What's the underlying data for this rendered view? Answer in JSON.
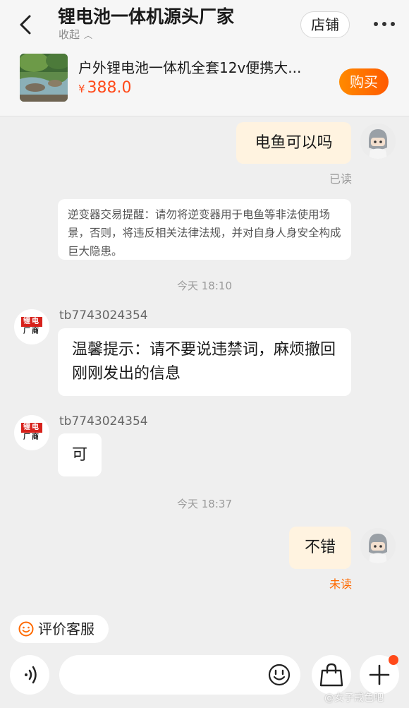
{
  "header": {
    "shop_name": "锂电池一体机源头厂家",
    "collapse_label": "收起",
    "store_button": "店铺",
    "more_icon": "more-dots-icon",
    "back_icon": "chevron-left-icon"
  },
  "product": {
    "title": "户外锂电池一体机全套12v便携大...",
    "currency": "¥",
    "price": "388.0",
    "buy_button": "购买"
  },
  "messages": {
    "m1": {
      "text": "电鱼可以吗",
      "status": "已读"
    },
    "notice": "逆变器交易提醒：请勿将逆变器用于电鱼等非法使用场景，否则，将违反相关法律法规，并对自身人身安全构成巨大隐患。",
    "time1": "今天 18:10",
    "m2": {
      "sender": "tb7743024354",
      "text": "温馨提示：请不要说违禁词，麻烦撤回刚刚发出的信息"
    },
    "m3": {
      "sender": "tb7743024354",
      "text": "可"
    },
    "time2": "今天 18:37",
    "m4": {
      "text": "不错",
      "status": "未读"
    },
    "shop_logo_top": "锂电",
    "shop_logo_bottom": "厂商"
  },
  "footer": {
    "rate_label": "评价客服",
    "voice_icon": "voice-icon",
    "emoji_icon": "emoji-icon",
    "bag_icon": "shopping-bag-icon",
    "plus_icon": "plus-icon"
  },
  "watermark": "@女子戒色吧",
  "colors": {
    "accent": "#ff5a00",
    "price": "#ff4a1a",
    "my_bubble": "#fff3e0",
    "background": "#efefef"
  }
}
